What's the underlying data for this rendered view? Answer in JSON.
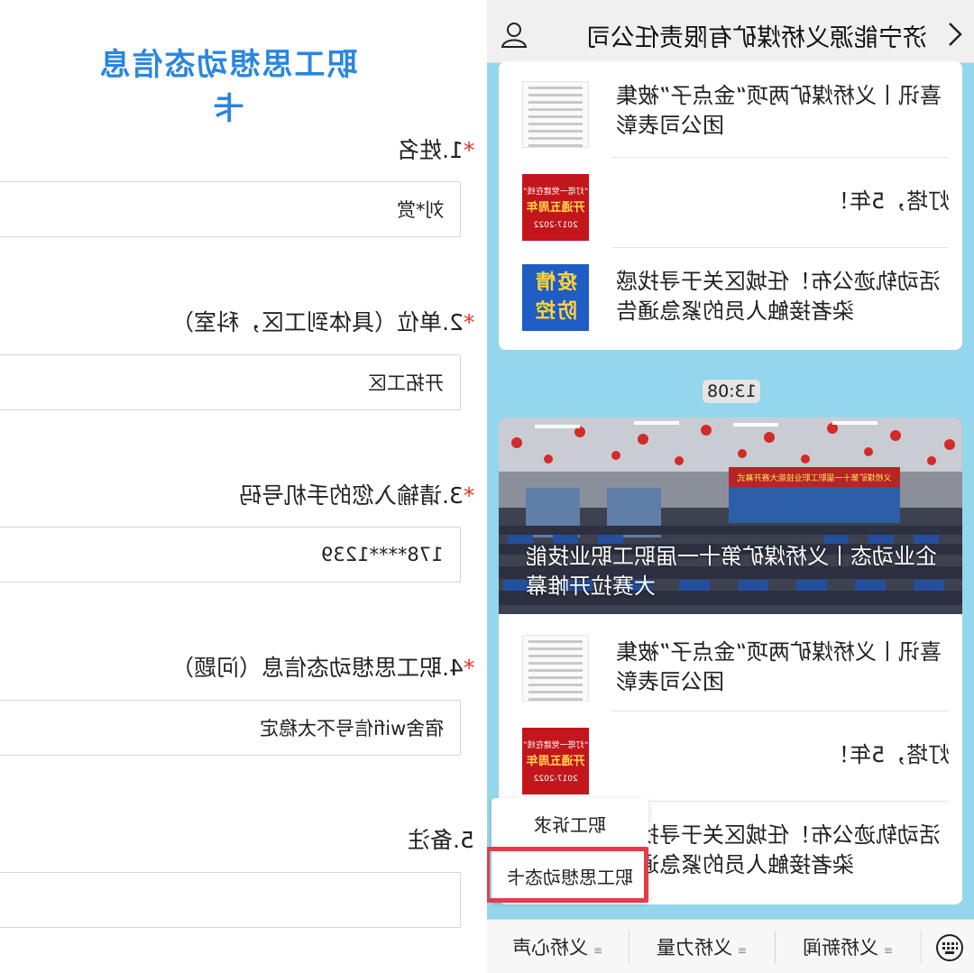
{
  "form": {
    "title": "职工思想动态信息卡",
    "questions": [
      {
        "required": "*",
        "label": "1.姓名",
        "value": "刘*赏"
      },
      {
        "required": "*",
        "label": "2.单位（具体到工区，科室）",
        "value": "开拓工区"
      },
      {
        "required": "*",
        "label": "3.请输入您的手机号码",
        "value": "178****1239"
      },
      {
        "required": "*",
        "label": "4.职工思想动态信息（问题）",
        "value": "宿舍wifi信号不太稳定"
      },
      {
        "required": "",
        "label": "5.备注",
        "value": ""
      }
    ]
  },
  "chat": {
    "header_title": "济宁能源义桥煤矿有限责任公司",
    "card1": [
      {
        "text": "喜讯丨义桥煤矿两项“金点子”被集团公司表彰",
        "thumb": "document"
      },
      {
        "text": "灯塔，5年！",
        "thumb": "red-anniversary"
      },
      {
        "text": "活动轨迹公布！任城区关于寻找感染者接触人员的紧急通告",
        "thumb": "epidemic-control"
      }
    ],
    "time": "13:08",
    "hero_caption": "企业动态丨义桥煤矿第十一届职工职业技能大赛拉开帷幕",
    "hero_banner": "义桥煤矿第十一届职工职业技能大赛开幕式",
    "card2": [
      {
        "text": "喜讯丨义桥煤矿两项“金点子”被集团公司表彰",
        "thumb": "document"
      },
      {
        "text": "灯塔，5年！",
        "thumb": "red-anniversary"
      },
      {
        "text": "活动轨迹公布！任城区关于寻找感染者接触人员的紧急通告",
        "thumb": "epidemic-control"
      }
    ],
    "thumb_red": {
      "line1": "“灯塔一党建在线”",
      "line2": "开通五周年",
      "line3": "2017-2022"
    },
    "thumb_blue": {
      "line1": "疫情",
      "line2": "防控"
    },
    "popup": {
      "item1": "职工诉求",
      "item2": "职工思想动态卡"
    },
    "menu": {
      "item1": "义桥心声",
      "item2": "义桥力量",
      "item3": "义桥新闻"
    },
    "colors": {
      "chat_bg": "#94d6eb",
      "title_blue": "#2a86e0",
      "highlight_red": "#e23d4b"
    }
  }
}
